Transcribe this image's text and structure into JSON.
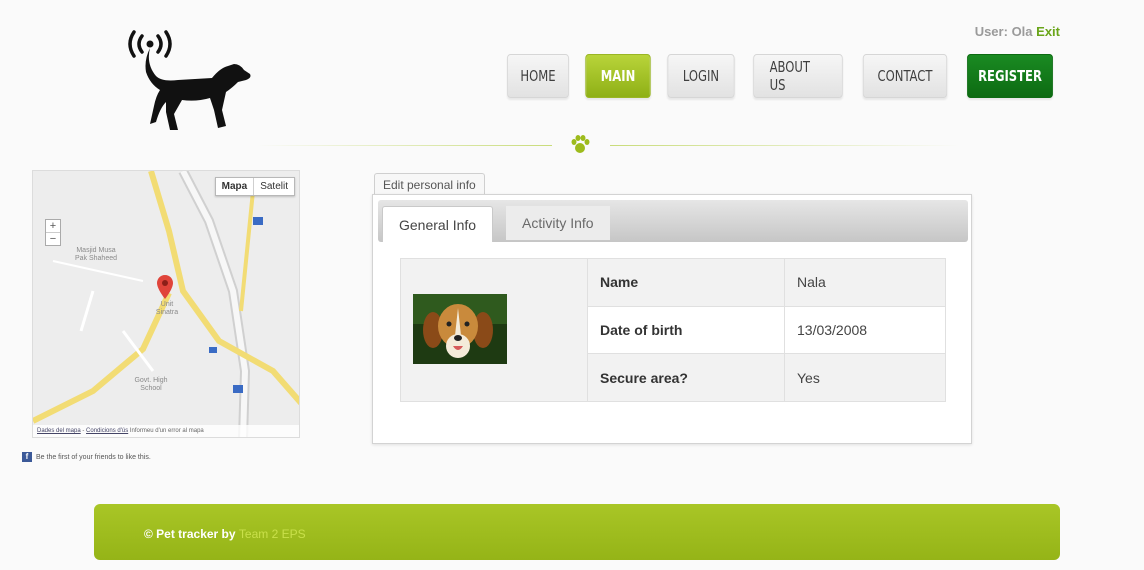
{
  "header": {
    "user_label": "User:",
    "user_name": "Ola",
    "exit_label": "Exit",
    "nav": [
      {
        "label": "HOME"
      },
      {
        "label": "MAIN"
      },
      {
        "label": "LOGIN"
      },
      {
        "label": "ABOUT US"
      },
      {
        "label": "CONTACT"
      },
      {
        "label": "REGISTER"
      }
    ],
    "active_nav": "MAIN"
  },
  "map": {
    "type_buttons": [
      "Mapa",
      "Satelit"
    ],
    "selected_type": "Mapa",
    "zoom_in": "+",
    "zoom_out": "−",
    "labels": [
      "Masjid Musa Pak Shaheed",
      "Unit Sinatra",
      "Govt. High School"
    ],
    "footer_links": [
      "Dades del mapa",
      "Condicions d'ús",
      "Informeu d'un error al mapa"
    ]
  },
  "facebook": {
    "text": "Be the first of your friends to like this."
  },
  "profile": {
    "edit_button": "Edit personal info",
    "tabs": [
      "General Info",
      "Activity Info"
    ],
    "active_tab": "General Info",
    "rows": [
      {
        "label": "Name",
        "value": "Nala"
      },
      {
        "label": "Date of birth",
        "value": "13/03/2008"
      },
      {
        "label": "Secure area?",
        "value": "Yes"
      }
    ]
  },
  "footer": {
    "prefix": "© Pet tracker by",
    "team": "Team 2 EPS"
  },
  "colors": {
    "accent": "#9dbb1c",
    "register": "#107a18",
    "footer": "#9dbb1c"
  }
}
